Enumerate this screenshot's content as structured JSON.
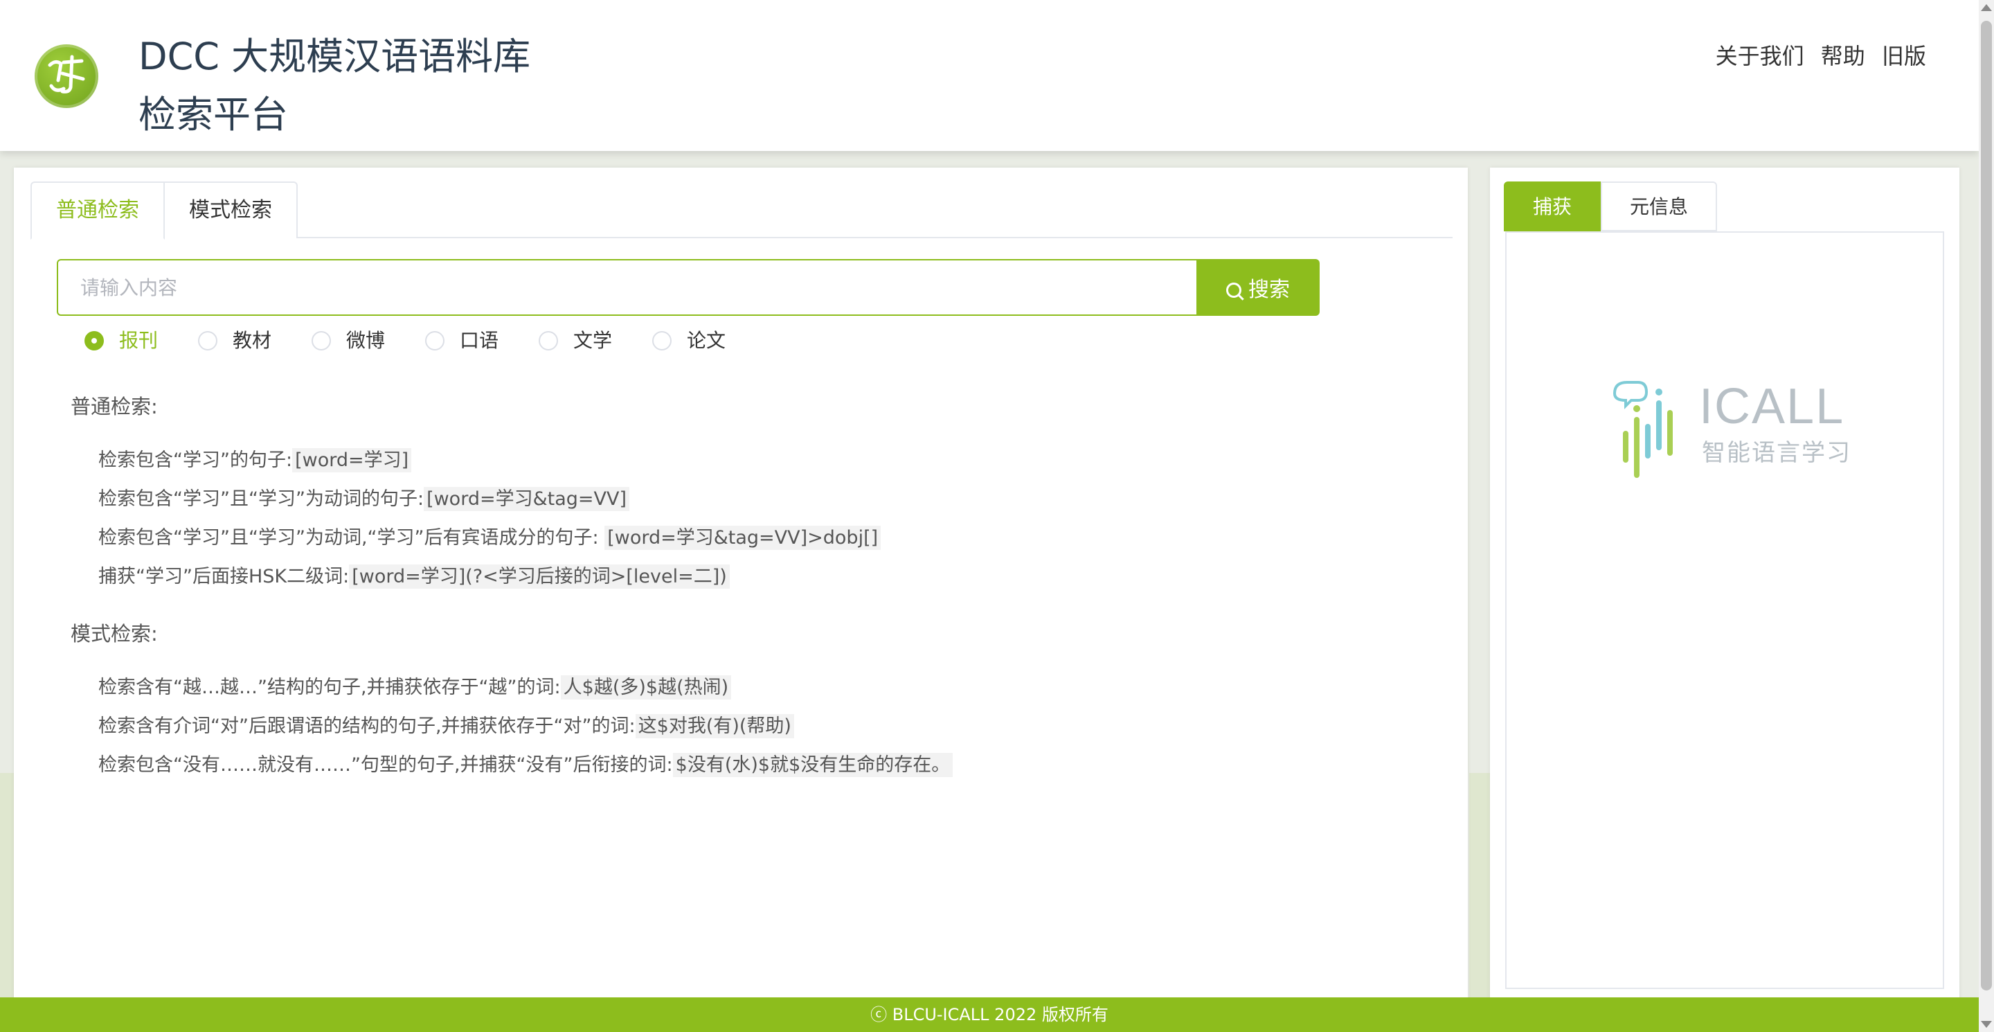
{
  "header": {
    "title_line1": "DCC 大规模汉语语料库",
    "title_line2": "检索平台",
    "nav": [
      "关于我们",
      "帮助",
      "旧版"
    ]
  },
  "left_panel": {
    "tabs": [
      {
        "label": "普通检索",
        "active": true
      },
      {
        "label": "模式检索",
        "active": false
      }
    ],
    "search": {
      "placeholder": "请输入内容",
      "value": "",
      "button_label": "搜索"
    },
    "corpora": [
      {
        "label": "报刊",
        "checked": true
      },
      {
        "label": "教材",
        "checked": false
      },
      {
        "label": "微博",
        "checked": false
      },
      {
        "label": "口语",
        "checked": false
      },
      {
        "label": "文学",
        "checked": false
      },
      {
        "label": "论文",
        "checked": false
      }
    ],
    "normal_section": {
      "title": "普通检索:",
      "examples": [
        {
          "text": "检索包含“学习”的句子:",
          "query": "[word=学习]"
        },
        {
          "text": "检索包含“学习”且“学习”为动词的句子:",
          "query": "[word=学习&tag=VV]"
        },
        {
          "text": "检索包含“学习”且“学习”为动词,“学习”后有宾语成分的句子:",
          "query": "[word=学习&tag=VV]>dobj[]"
        },
        {
          "text": "捕获“学习”后面接HSK二级词:",
          "query": "[word=学习](?<学习后接的词>[level=二])"
        }
      ]
    },
    "pattern_section": {
      "title": "模式检索:",
      "examples": [
        {
          "text": "检索含有“越…越…”结构的句子,并捕获依存于“越”的词:",
          "query": "人$越(多)$越(热闹)"
        },
        {
          "text": "检索含有介词“对”后跟谓语的结构的句子,并捕获依存于“对”的词:",
          "query": "这$对我(有)(帮助)"
        },
        {
          "text": "检索包含“没有……就没有……”句型的句子,并捕获“没有”后衔接的词:",
          "query": "$没有(水)$就$没有生命的存在。"
        }
      ]
    }
  },
  "right_panel": {
    "tabs": [
      {
        "label": "捕获",
        "active": true
      },
      {
        "label": "元信息",
        "active": false
      }
    ],
    "logo_text": "ICALL",
    "logo_subtitle": "智能语言学习"
  },
  "footer": {
    "text": "ⓒ BLCU-ICALL 2022 版权所有"
  },
  "colors": {
    "accent": "#8dbd1d",
    "title": "#2d3e50",
    "background": "#e9ece4"
  },
  "icons": [
    "site-logo-icon",
    "search-icon",
    "icall-logo-icon"
  ]
}
